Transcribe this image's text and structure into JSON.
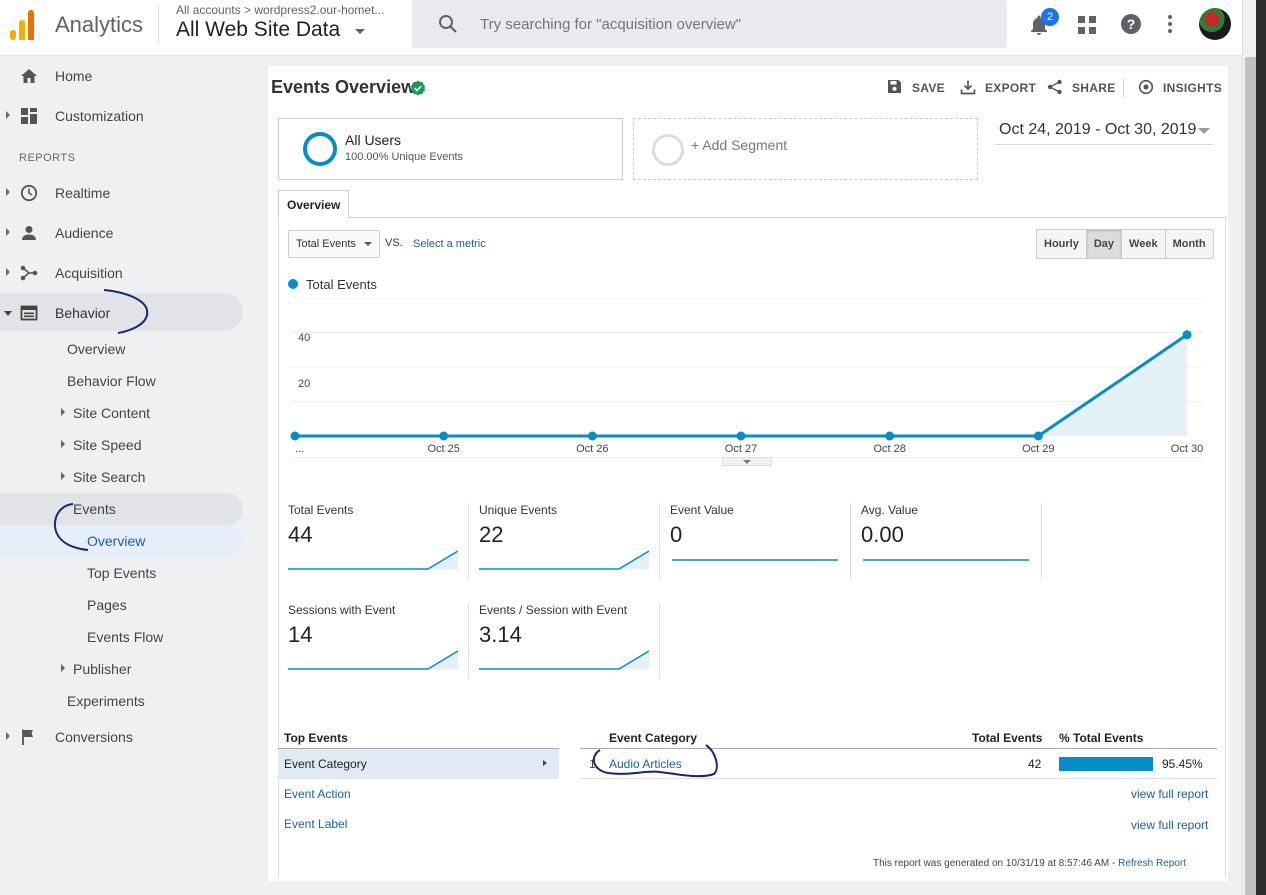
{
  "topbar": {
    "app_name": "Analytics",
    "account_breadcrumb": "All accounts > wordpress2.our-homet...",
    "view_name": "All Web Site Data",
    "search_placeholder": "Try searching for \"acquisition overview\"",
    "notification_count": "2",
    "icons": [
      "search-icon",
      "bell-icon",
      "apps-grid-icon",
      "help-icon",
      "more-vert-icon",
      "avatar"
    ]
  },
  "sidebar": {
    "home": "Home",
    "customization": "Customization",
    "reports_header": "REPORTS",
    "realtime": "Realtime",
    "audience": "Audience",
    "acquisition": "Acquisition",
    "behavior": "Behavior",
    "behavior_items": {
      "overview": "Overview",
      "behavior_flow": "Behavior Flow",
      "site_content": "Site Content",
      "site_speed": "Site Speed",
      "site_search": "Site Search",
      "events": "Events",
      "events_overview": "Overview",
      "top_events": "Top Events",
      "pages": "Pages",
      "events_flow": "Events Flow",
      "publisher": "Publisher",
      "experiments": "Experiments"
    },
    "conversions": "Conversions"
  },
  "header": {
    "title": "Events Overview",
    "actions": {
      "save": "SAVE",
      "export": "EXPORT",
      "share": "SHARE",
      "insights": "INSIGHTS"
    }
  },
  "segments": {
    "all_users_name": "All Users",
    "all_users_sub": "100.00% Unique Events",
    "add_segment": "+ Add Segment"
  },
  "date_range": "Oct 24, 2019 - Oct 30, 2019",
  "tabs": {
    "overview": "Overview"
  },
  "chart_controls": {
    "metric": "Total Events",
    "vs": "VS.",
    "select_metric": "Select a metric",
    "granularity": [
      "Hourly",
      "Day",
      "Week",
      "Month"
    ],
    "selected_granularity": "Day",
    "legend": "Total Events"
  },
  "chart_data": {
    "type": "area",
    "x": [
      "...",
      "Oct 25",
      "Oct 26",
      "Oct 27",
      "Oct 28",
      "Oct 29",
      "Oct 30"
    ],
    "series": [
      {
        "name": "Total Events",
        "values": [
          0,
          0,
          0,
          0,
          0,
          0,
          44
        ]
      }
    ],
    "y_ticks": [
      "60",
      "40",
      "20"
    ],
    "ylim": [
      0,
      60
    ],
    "grid": true,
    "legend_placement": "top-left",
    "color": "#058dc7"
  },
  "scorecards": [
    {
      "label": "Total Events",
      "value": "44"
    },
    {
      "label": "Unique Events",
      "value": "22"
    },
    {
      "label": "Event Value",
      "value": "0"
    },
    {
      "label": "Avg. Value",
      "value": "0.00"
    },
    {
      "label": "Sessions with Event",
      "value": "14"
    },
    {
      "label": "Events / Session with Event",
      "value": "3.14"
    }
  ],
  "top_events": {
    "header": "Top Events",
    "rows": [
      "Event Category",
      "Event Action",
      "Event Label"
    ]
  },
  "report_table": {
    "col_category": "Event Category",
    "col_total": "Total Events",
    "col_pct": "% Total Events",
    "row_index": "1.",
    "row_category": "Audio Articles",
    "row_total": "42",
    "row_pct": "95.45%",
    "row_pct_fraction": 0.9545
  },
  "view_full_report": "view full report",
  "footer": {
    "generated": "This report was generated on 10/31/19 at 8:57:46 AM - ",
    "refresh": "Refresh Report"
  }
}
